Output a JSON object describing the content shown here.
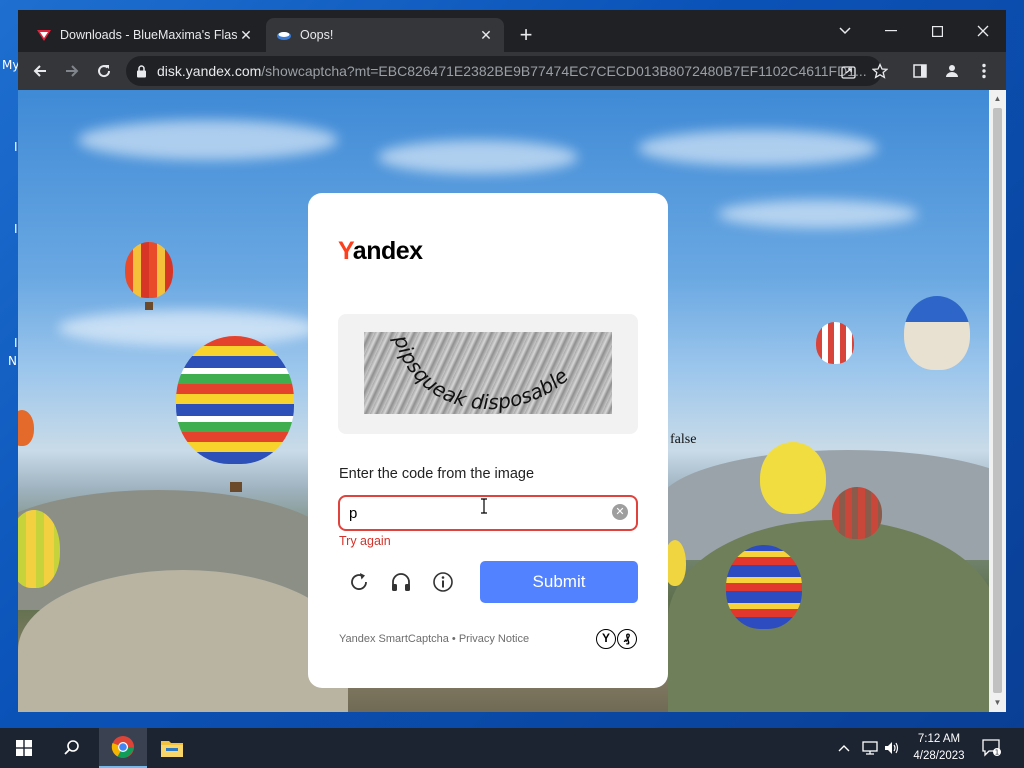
{
  "desktop": {
    "fragments": [
      "My",
      "I",
      "I",
      "I",
      "N"
    ]
  },
  "tabs": [
    {
      "title": "Downloads - BlueMaxima's Flashpoint",
      "active": false,
      "icon": "flashpoint-icon"
    },
    {
      "title": "Oops!",
      "active": true,
      "icon": "yandex-disk-icon"
    }
  ],
  "address_bar": {
    "host": "disk.yandex.com",
    "path": "/showcaptcha?mt=EBC826471E2382BE9B77474EC7CECD013B8072480B7EF1102C4611FD1..."
  },
  "page": {
    "stray_text": "false",
    "captcha": {
      "logo_first_letter": "Y",
      "logo_rest": "andex",
      "image_text": "pipsqueak disposable",
      "prompt": "Enter the code from the image",
      "input_value": "p",
      "error": "Try again",
      "submit_label": "Submit",
      "footer": "Yandex SmartCaptcha • Privacy Notice",
      "badge_1": "Y",
      "badge_2": "₰"
    }
  },
  "taskbar": {
    "time": "7:12 AM",
    "date": "4/28/2023",
    "notification_count": "1"
  },
  "colors": {
    "error_red": "#e0423c",
    "submit_blue": "#5282ff",
    "yandex_red": "#fc3f1d"
  }
}
